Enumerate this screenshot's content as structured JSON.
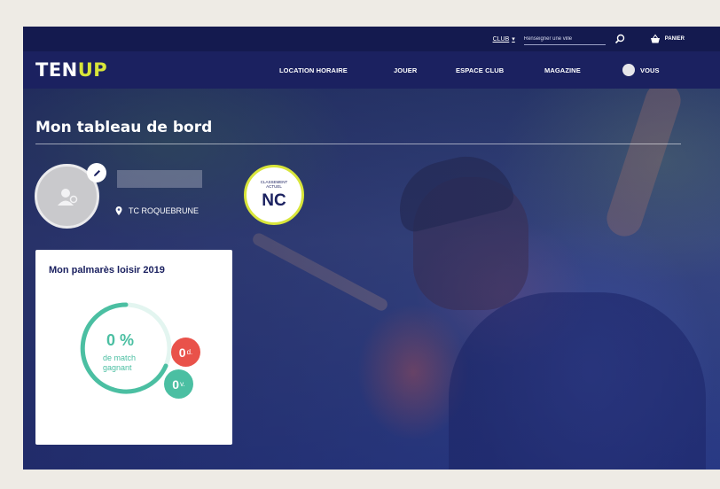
{
  "utility_bar": {
    "club_label": "CLUB",
    "city_placeholder": "Renseigner une ville",
    "cart_label": "PANIER"
  },
  "nav": {
    "logo_prefix": "TEN",
    "logo_suffix": "UP",
    "items": [
      {
        "label": "LOCATION HORAIRE"
      },
      {
        "label": "JOUER"
      },
      {
        "label": "ESPACE CLUB"
      },
      {
        "label": "MAGAZINE"
      }
    ],
    "account_label": "VOUS"
  },
  "dashboard": {
    "title": "Mon tableau de bord",
    "club_name": "TC ROQUEBRUNE",
    "ranking_label": "CLASSEMENT\nACTUEL",
    "ranking_value": "NC"
  },
  "palmares": {
    "title": "Mon palmarès loisir 2019",
    "percent_text": "0 %",
    "percent_sub": "de match\ngagnant",
    "win_ratio": 0,
    "defeats": "0",
    "defeats_suffix": "d.",
    "victories": "0",
    "victories_suffix": "v."
  },
  "colors": {
    "navy": "#1b2160",
    "accent_yellow": "#d8e53a",
    "teal": "#4bbfa2",
    "red": "#e9524a"
  }
}
